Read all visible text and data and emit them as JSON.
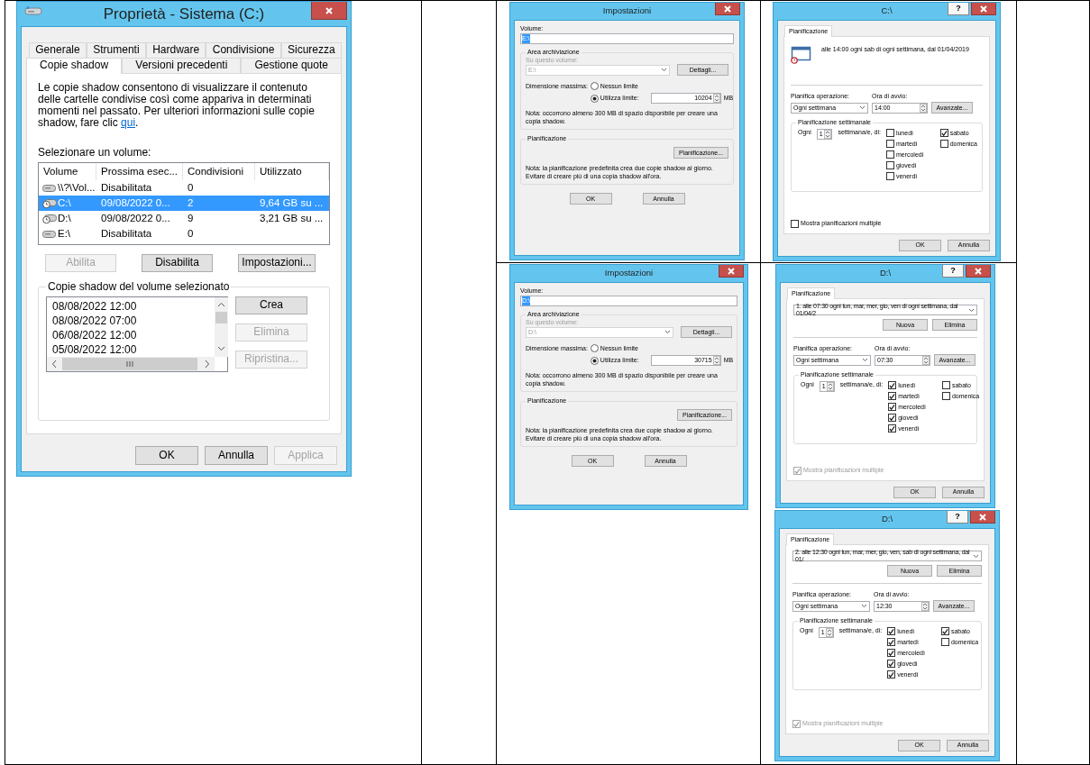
{
  "properties": {
    "title": "Proprietà - Sistema (C:)",
    "tab_rows": [
      [
        {
          "label": "Generale",
          "selected": false
        },
        {
          "label": "Strumenti",
          "selected": false
        },
        {
          "label": "Hardware",
          "selected": false
        },
        {
          "label": "Condivisione",
          "selected": false
        },
        {
          "label": "Sicurezza",
          "selected": false
        }
      ],
      [
        {
          "label": "Copie shadow",
          "selected": true
        },
        {
          "label": "Versioni precedenti",
          "selected": false
        },
        {
          "label": "Gestione quote",
          "selected": false
        }
      ]
    ],
    "description": "Le copie shadow consentono di visualizzare il contenuto delle cartelle condivise così come appariva in determinati momenti nel passato. Per ulteriori informazioni sulle copie shadow, fare clic ",
    "link": "qui",
    "description_end": ".",
    "volume_label": "Selezionare un volume:",
    "columns": [
      "Volume",
      "Prossima esec...",
      "Condivisioni",
      "Utilizzato"
    ],
    "volumes": [
      {
        "kind": "drive",
        "selected": false,
        "volume": "\\\\?\\Vol...",
        "next_run": "Disabilitata",
        "shares": "0"
      },
      {
        "kind": "scheduled-drive",
        "selected": true,
        "volume": "C:\\",
        "next_run": "09/08/2022 0...",
        "shares": "2",
        "used": "9,64 GB su ..."
      },
      {
        "kind": "scheduled-drive",
        "selected": false,
        "volume": "D:\\",
        "next_run": "09/08/2022 0...",
        "shares": "9",
        "used": "3,21 GB su ..."
      },
      {
        "kind": "drive",
        "selected": false,
        "volume": "E:\\",
        "next_run": "Disabilitata",
        "shares": "0"
      }
    ],
    "volume_buttons": [
      {
        "label": "Abilita",
        "disabled": true
      },
      {
        "label": "Disabilita",
        "disabled": false
      },
      {
        "label": "Impostazioni...",
        "disabled": false
      }
    ],
    "copies_title": "Copie shadow del volume selezionato",
    "copies": [
      "08/08/2022 12:00",
      "08/08/2022 07:00",
      "06/08/2022 12:00",
      "05/08/2022 12:00"
    ],
    "copy_buttons": [
      {
        "label": "Crea",
        "disabled": false
      },
      {
        "label": "Elimina",
        "disabled": true
      },
      {
        "label": "Ripristina...",
        "disabled": true
      }
    ],
    "buttons": [
      {
        "label": "OK",
        "disabled": false
      },
      {
        "label": "Annulla",
        "disabled": false
      },
      {
        "label": "Applica",
        "disabled": true
      }
    ]
  },
  "settings_dialogs": [
    {
      "title": "Impostazioni",
      "volume_label": "Volume:",
      "volume_value": "E:\\",
      "storage_title": "Area archiviazione",
      "on_volume_label": "Su questo volume:",
      "on_volume_value": "E:\\",
      "on_volume_disabled": true,
      "details_button": "Dettagli...",
      "max_size_label": "Dimensione massima:",
      "limits": [
        {
          "label": "Nessun limite",
          "selected": false
        },
        {
          "label": "Utilizza limite:",
          "selected": true
        }
      ],
      "limit_value": "10204",
      "unit": "MB",
      "note": "Nota: occorrono almeno 300 MB di spazio disponibile per creare una copia shadow.",
      "schedule_title": "Pianificazione",
      "schedule_button": "Pianificazione...",
      "schedule_note": "Nota: la pianificazione predefinita crea due copie shadow al giorno. Evitare di creare più di una copia shadow all'ora.",
      "buttons": [
        "OK",
        "Annulla"
      ]
    },
    {
      "title": "Impostazioni",
      "volume_label": "Volume:",
      "volume_value": "D:\\",
      "storage_title": "Area archiviazione",
      "on_volume_label": "Su questo volume:",
      "on_volume_value": "D:\\",
      "on_volume_disabled": true,
      "details_button": "Dettagli...",
      "max_size_label": "Dimensione massima:",
      "limits": [
        {
          "label": "Nessun limite",
          "selected": false
        },
        {
          "label": "Utilizza limite:",
          "selected": true
        }
      ],
      "limit_value": "30715",
      "unit": "MB",
      "note": "Nota: occorrono almeno 300 MB di spazio disponibile per creare una copia shadow.",
      "schedule_title": "Pianificazione",
      "schedule_button": "Pianificazione...",
      "schedule_note": "Nota: la pianificazione predefinita crea due copie shadow al giorno. Evitare di creare più di una copia shadow all'ora.",
      "buttons": [
        "OK",
        "Annulla"
      ]
    }
  ],
  "schedule_dialogs": [
    {
      "title": "C:\\",
      "help": "?",
      "tab": "Pianificazione",
      "kind": "single",
      "summary": "alle 14:00 ogni sab di ogni settimana, dal 01/04/2019",
      "task_label": "Pianifica operazione:",
      "task_value": "Ogni settimana",
      "time_label": "Ora di avvio:",
      "time_value": "14:00",
      "advanced_button": "Avanzate...",
      "weekly_title": "Pianificazione settimanale",
      "every_label": "Ogni",
      "every_value": "1",
      "weeks_label": "settimana/e, di:",
      "days": [
        {
          "label": "lunedì",
          "checked": false
        },
        {
          "label": "martedì",
          "checked": false
        },
        {
          "label": "mercoledì",
          "checked": false
        },
        {
          "label": "giovedì",
          "checked": false
        },
        {
          "label": "venerdì",
          "checked": false
        },
        {
          "label": "sabato",
          "checked": true
        },
        {
          "label": "domenica",
          "checked": false
        }
      ],
      "show_multiple": {
        "label": "Mostra pianificazioni multiple",
        "checked": false,
        "disabled": false
      },
      "buttons": [
        "OK",
        "Annulla"
      ]
    },
    {
      "title": "D:\\",
      "help": "?",
      "tab": "Pianificazione",
      "kind": "multiple",
      "schedule": "1. alle 07:30 ogni lun, mar, mer, gio, ven di ogni settimana, dal 01/04/2",
      "new_button": "Nuova",
      "delete_button": "Elimina",
      "task_label": "Pianifica operazione:",
      "task_value": "Ogni settimana",
      "time_label": "Ora di avvio:",
      "time_value": "07:30",
      "advanced_button": "Avanzate...",
      "weekly_title": "Pianificazione settimanale",
      "every_label": "Ogni",
      "every_value": "1",
      "weeks_label": "settimana/e, di:",
      "days": [
        {
          "label": "lunedì",
          "checked": true
        },
        {
          "label": "martedì",
          "checked": true
        },
        {
          "label": "mercoledì",
          "checked": true
        },
        {
          "label": "giovedì",
          "checked": true
        },
        {
          "label": "venerdì",
          "checked": true
        },
        {
          "label": "sabato",
          "checked": false
        },
        {
          "label": "domenica",
          "checked": false
        }
      ],
      "show_multiple": {
        "label": "Mostra pianificazioni multiple",
        "checked": true,
        "disabled": true
      },
      "buttons": [
        "OK",
        "Annulla"
      ]
    },
    {
      "title": "D:\\",
      "help": "?",
      "tab": "Pianificazione",
      "kind": "multiple",
      "schedule": "2. alle 12:30 ogni lun, mar, mer, gio, ven, sab di ogni settimana, dal 01/",
      "new_button": "Nuova",
      "delete_button": "Elimina",
      "task_label": "Pianifica operazione:",
      "task_value": "Ogni settimana",
      "time_label": "Ora di avvio:",
      "time_value": "12:30",
      "advanced_button": "Avanzate...",
      "weekly_title": "Pianificazione settimanale",
      "every_label": "Ogni",
      "every_value": "1",
      "weeks_label": "settimana/e, di:",
      "days": [
        {
          "label": "lunedì",
          "checked": true
        },
        {
          "label": "martedì",
          "checked": true
        },
        {
          "label": "mercoledì",
          "checked": true
        },
        {
          "label": "giovedì",
          "checked": true
        },
        {
          "label": "venerdì",
          "checked": true
        },
        {
          "label": "sabato",
          "checked": true
        },
        {
          "label": "domenica",
          "checked": false
        }
      ],
      "show_multiple": {
        "label": "Mostra pianificazioni multiple",
        "checked": true,
        "disabled": true
      },
      "buttons": [
        "OK",
        "Annulla"
      ]
    }
  ]
}
